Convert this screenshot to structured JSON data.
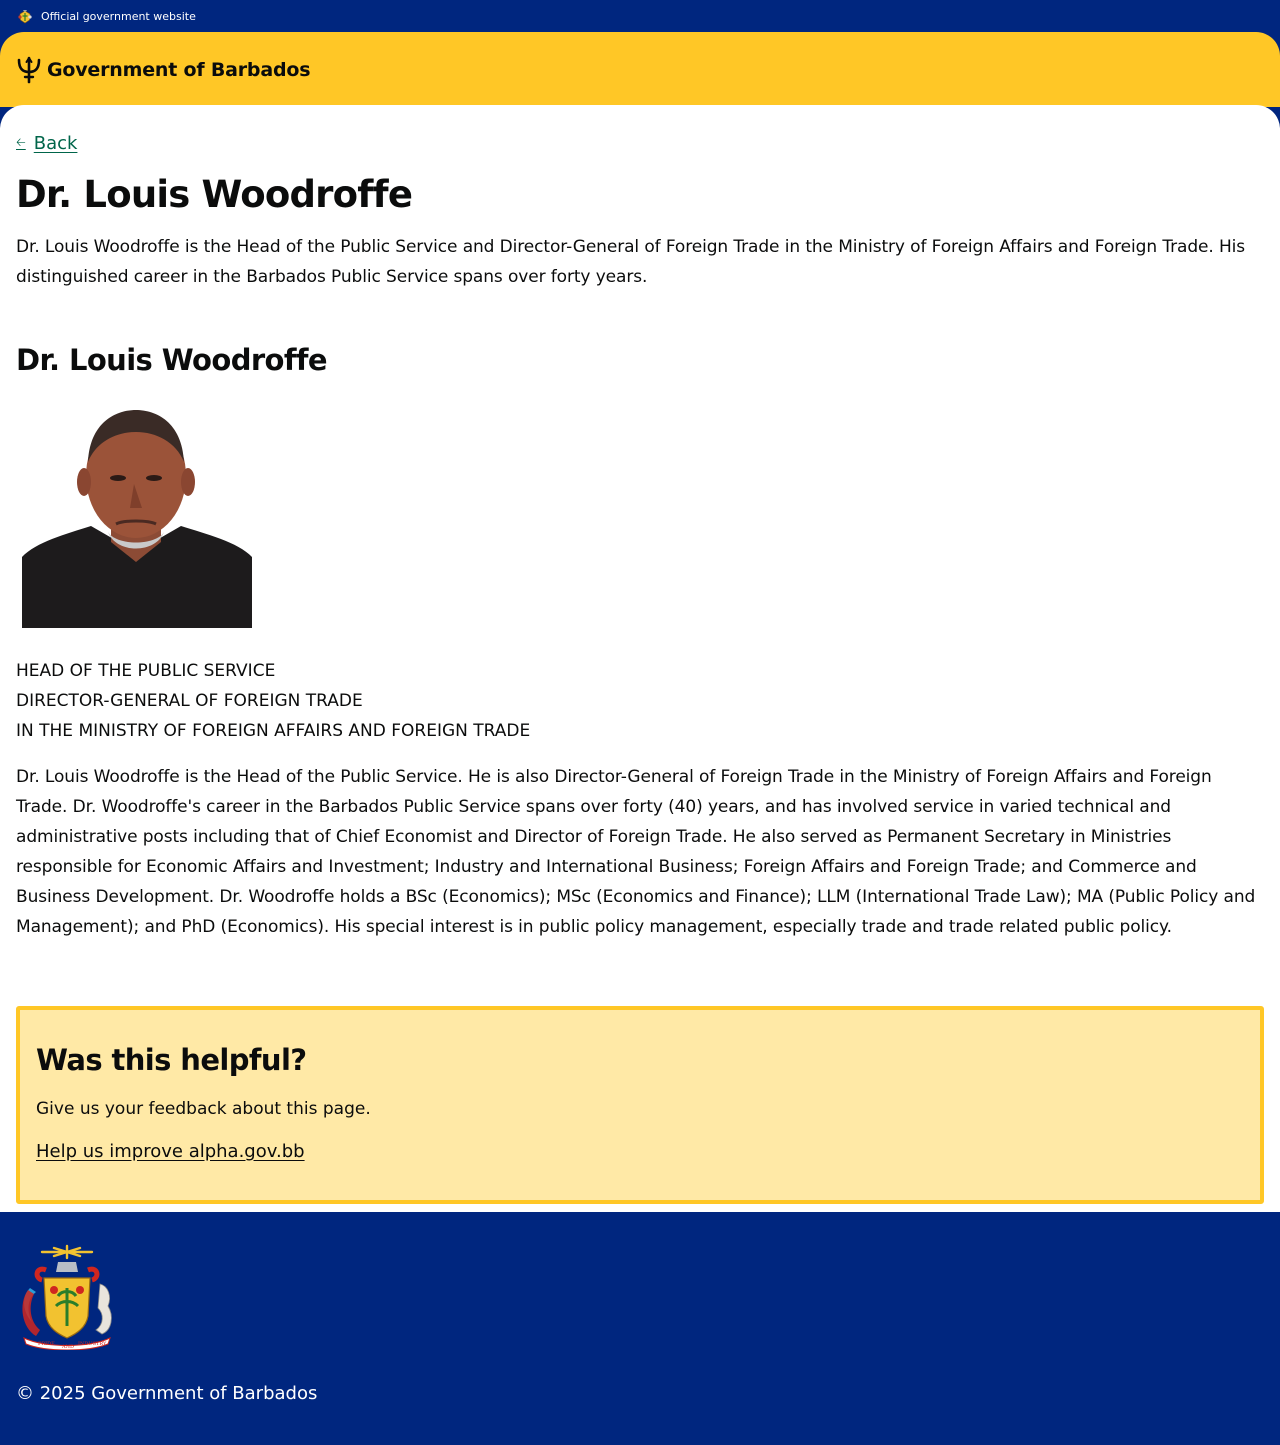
{
  "topbar": {
    "text": "Official government website",
    "icon": "coat-of-arms-icon"
  },
  "header": {
    "brand": "Government of Barbados",
    "icon": "trident-icon",
    "colors": {
      "yellow": "#ffc726",
      "blue": "#00267f"
    }
  },
  "main": {
    "back_label": "Back",
    "title": "Dr. Louis Woodroffe",
    "lead": "Dr. Louis Woodroffe is the Head of the Public Service and Director-General of Foreign Trade in the Ministry of Foreign Affairs and Foreign Trade. His distinguished career in the Barbados Public Service spans over forty years.",
    "section_title": "Dr. Louis Woodroffe",
    "titles": [
      "HEAD OF THE PUBLIC SERVICE",
      "DIRECTOR-GENERAL OF FOREIGN TRADE",
      "IN THE MINISTRY OF FOREIGN AFFAIRS AND FOREIGN TRADE"
    ],
    "bio": "Dr. Louis Woodroffe is the Head of the Public Service. He is also Director-General of Foreign Trade in the Ministry of Foreign Affairs and Foreign Trade. Dr. Woodroffe's career in the Barbados Public Service spans over forty (40) years, and has involved service in varied technical and administrative posts including that of Chief Economist and Director of Foreign Trade. He also served as Permanent Secretary in Ministries responsible for Economic Affairs and Investment; Industry and International Business; Foreign Affairs and Foreign Trade; and Commerce and Business Development. Dr. Woodroffe holds a BSc (Economics); MSc (Economics and Finance); LLM (International Trade Law); MA (Public Policy and Management); and PhD (Economics). His special interest is in public policy management, especially trade and trade related public policy."
  },
  "feedback": {
    "title": "Was this helpful?",
    "text": "Give us your feedback about this page.",
    "link": "Help us improve alpha.gov.bb"
  },
  "footer": {
    "crest_motto": [
      "PRIDE",
      "AND",
      "INDUSTRY"
    ],
    "copyright": "© 2025 Government of Barbados"
  }
}
